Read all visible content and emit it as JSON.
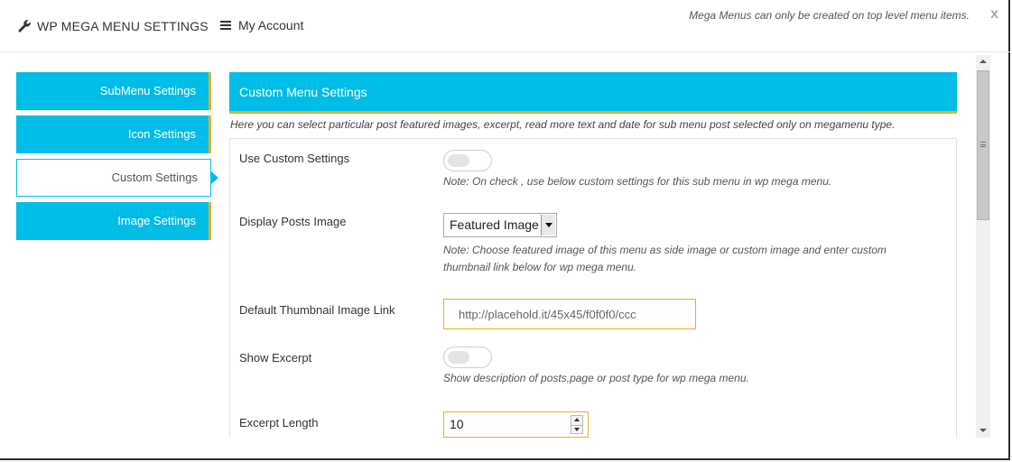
{
  "header": {
    "title": "WP MEGA MENU SETTINGS",
    "title_icon": "wrench-icon",
    "account_label": "My Account",
    "account_icon": "hamburger-menu-icon",
    "notice": "Mega Menus can only be created on top level menu items.",
    "close_label": "x"
  },
  "sidebar": {
    "items": [
      {
        "label": "SubMenu Settings",
        "active": false
      },
      {
        "label": "Icon Settings",
        "active": false
      },
      {
        "label": "Custom Settings",
        "active": true
      },
      {
        "label": "Image Settings",
        "active": false
      }
    ]
  },
  "panel": {
    "title": "Custom Menu Settings",
    "intro": "Here you can select particular post featured images, excerpt, read more text and date for sub menu post selected only on megamenu type.",
    "fields": {
      "use_custom": {
        "label": "Use Custom Settings",
        "checked": false,
        "note": "Note: On check , use below custom settings for this sub menu in wp mega menu."
      },
      "display_image": {
        "label": "Display Posts Image",
        "selected": "Featured Image",
        "note": "Note: Choose featured image of this menu as side image or custom image and enter custom thumbnail link below for wp mega menu."
      },
      "thumbnail_link": {
        "label": "Default Thumbnail Image Link",
        "value": "http://placehold.it/45x45/f0f0f0/ccc"
      },
      "show_excerpt": {
        "label": "Show Excerpt",
        "checked": false,
        "note": "Show description of posts,page or post type for wp mega menu."
      },
      "excerpt_length": {
        "label": "Excerpt Length",
        "value": "10"
      }
    }
  },
  "colors": {
    "accent": "#00bde8",
    "accent_border": "#e0b02e"
  }
}
